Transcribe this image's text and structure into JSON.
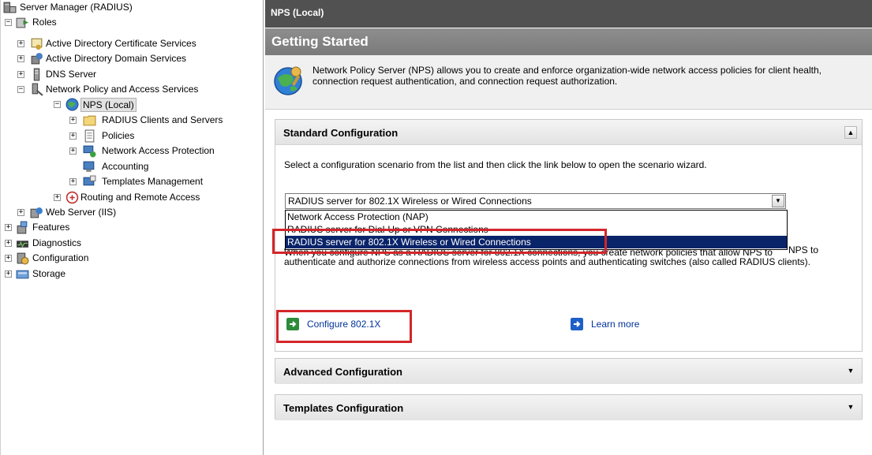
{
  "tree": {
    "nodes": [
      {
        "label": "Server Manager (RADIUS)"
      },
      {
        "label": "Roles"
      },
      {
        "label": "Active Directory Certificate Services"
      },
      {
        "label": "Active Directory Domain Services"
      },
      {
        "label": "DNS Server"
      },
      {
        "label": "Network Policy and Access Services"
      },
      {
        "label": "NPS (Local)"
      },
      {
        "label": "RADIUS Clients and Servers"
      },
      {
        "label": "Policies"
      },
      {
        "label": "Network Access Protection"
      },
      {
        "label": "Accounting"
      },
      {
        "label": "Templates Management"
      },
      {
        "label": "Routing and Remote Access"
      },
      {
        "label": "Web Server (IIS)"
      },
      {
        "label": "Features"
      },
      {
        "label": "Diagnostics"
      },
      {
        "label": "Configuration"
      },
      {
        "label": "Storage"
      }
    ]
  },
  "header": {
    "title": "NPS (Local)"
  },
  "getting_started": {
    "title": "Getting Started",
    "intro": "Network Policy Server (NPS) allows you to create and enforce organization-wide network access policies for client health, connection request authentication, and connection request authorization."
  },
  "standard": {
    "title": "Standard Configuration",
    "description": "Select a configuration scenario from the list and then click the link below to open the scenario wizard.",
    "selected": "RADIUS server for 802.1X Wireless or Wired Connections",
    "options": [
      "Network Access Protection (NAP)",
      "RADIUS server for Dial-Up or VPN Connections",
      "RADIUS server for 802.1X Wireless or Wired Connections"
    ],
    "behind_text_1": "When you configure NPS as a RADIUS server for 802.1X connections, you create network policies that allow NPS to",
    "behind_text_tail": "NPS to",
    "behind_text_2": "authenticate and authorize connections from wireless access points and authenticating switches (also called RADIUS clients).",
    "configure_link": "Configure 802.1X",
    "learn_more": "Learn more"
  },
  "advanced": {
    "title": "Advanced Configuration"
  },
  "templates": {
    "title": "Templates Configuration"
  },
  "colors": {
    "highlight": "#d3262a",
    "selection": "#0a246a"
  }
}
